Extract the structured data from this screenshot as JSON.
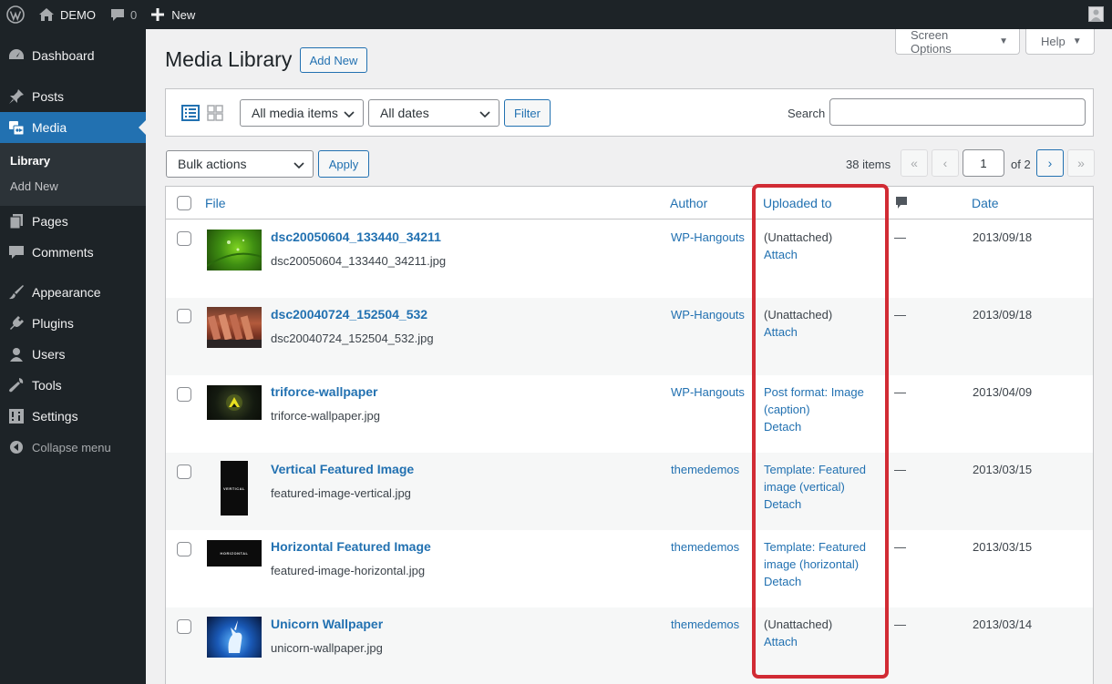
{
  "adminbar": {
    "site_name": "DEMO",
    "comment_count": "0",
    "new_label": "New"
  },
  "sidebar": {
    "items": [
      {
        "label": "Dashboard"
      },
      {
        "label": "Posts"
      },
      {
        "label": "Media"
      },
      {
        "label": "Pages"
      },
      {
        "label": "Comments"
      },
      {
        "label": "Appearance"
      },
      {
        "label": "Plugins"
      },
      {
        "label": "Users"
      },
      {
        "label": "Tools"
      },
      {
        "label": "Settings"
      }
    ],
    "submenu": [
      {
        "label": "Library"
      },
      {
        "label": "Add New"
      }
    ],
    "collapse_label": "Collapse menu"
  },
  "header": {
    "title": "Media Library",
    "add_new": "Add New",
    "screen_options": "Screen Options",
    "help": "Help"
  },
  "filters": {
    "type_select": "All media items",
    "date_select": "All dates",
    "filter_button": "Filter",
    "search_label": "Search",
    "search_value": ""
  },
  "bulk": {
    "select": "Bulk actions",
    "apply": "Apply",
    "items_count": "38 items",
    "page_current": "1",
    "page_of": "of 2",
    "first": "«",
    "prev": "‹",
    "next": "›",
    "last": "»"
  },
  "table": {
    "columns": {
      "file": "File",
      "author": "Author",
      "uploaded_to": "Uploaded to",
      "date": "Date"
    },
    "rows": [
      {
        "title": "dsc20050604_133440_34211",
        "filename": "dsc20050604_133440_34211.jpg",
        "author": "WP-Hangouts",
        "uploaded_to": "(Unattached)",
        "action": "Attach",
        "comments": "—",
        "date": "2013/09/18"
      },
      {
        "title": "dsc20040724_152504_532",
        "filename": "dsc20040724_152504_532.jpg",
        "author": "WP-Hangouts",
        "uploaded_to": "(Unattached)",
        "action": "Attach",
        "comments": "—",
        "date": "2013/09/18"
      },
      {
        "title": "triforce-wallpaper",
        "filename": "triforce-wallpaper.jpg",
        "author": "WP-Hangouts",
        "uploaded_to_line1": "Post format: Image",
        "uploaded_to_line2": "(caption)",
        "action": "Detach",
        "comments": "—",
        "date": "2013/04/09"
      },
      {
        "title": "Vertical Featured Image",
        "filename": "featured-image-vertical.jpg",
        "author": "themedemos",
        "uploaded_to_line1": "Template: Featured",
        "uploaded_to_line2": "image (vertical)",
        "action": "Detach",
        "comments": "—",
        "date": "2013/03/15"
      },
      {
        "title": "Horizontal Featured Image",
        "filename": "featured-image-horizontal.jpg",
        "author": "themedemos",
        "uploaded_to_line1": "Template: Featured",
        "uploaded_to_line2": "image (horizontal)",
        "action": "Detach",
        "comments": "—",
        "date": "2013/03/15"
      },
      {
        "title": "Unicorn Wallpaper",
        "filename": "unicorn-wallpaper.jpg",
        "author": "themedemos",
        "uploaded_to": "(Unattached)",
        "action": "Attach",
        "comments": "—",
        "date": "2013/03/14"
      }
    ],
    "thumb_text": {
      "vertical": "VERTICAL",
      "horizontal": "HORIZONTAL"
    }
  },
  "colors": {
    "accent": "#2271b1",
    "highlight": "#d12b34",
    "sidebar": "#1d2327"
  }
}
